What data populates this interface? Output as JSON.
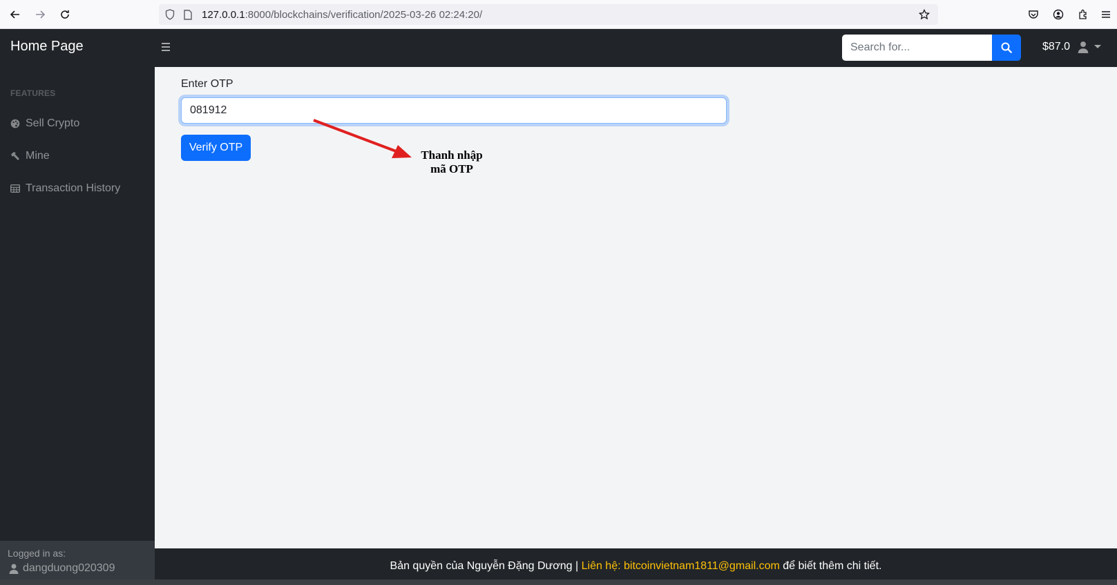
{
  "browser": {
    "url_host": "127.0.0.1",
    "url_path": ":8000/blockchains/verification/2025-03-26 02:24:20/",
    "icons": [
      "back-icon",
      "forward-icon",
      "reload-icon",
      "shield-icon",
      "page-icon",
      "bookmark-star-icon",
      "pocket-icon",
      "account-icon",
      "extensions-icon",
      "menu-icon"
    ]
  },
  "navbar": {
    "brand": "Home Page",
    "search_placeholder": "Search for...",
    "balance": "$87.0"
  },
  "sidebar": {
    "heading": "FEATURES",
    "items": [
      {
        "label": "Sell Crypto",
        "icon": "palette-icon"
      },
      {
        "label": "Mine",
        "icon": "hammer-icon"
      },
      {
        "label": "Transaction History",
        "icon": "table-icon"
      }
    ],
    "footer_label": "Logged in as:",
    "username": "dangduong020309"
  },
  "form": {
    "label": "Enter OTP",
    "value": "081912",
    "button": "Verify OTP"
  },
  "annotation": {
    "line1": "Thanh nhập",
    "line2": "mã OTP",
    "color": "#e02020"
  },
  "footer": {
    "prefix": "Bản quyền của Nguyễn Đặng Dương | ",
    "contact": "Liên hệ: bitcoinvietnam1811@gmail.com",
    "suffix": " để biết thêm chi tiết."
  },
  "colors": {
    "primary": "#0d6efd",
    "dark": "#212529",
    "contact": "#ffc107"
  }
}
